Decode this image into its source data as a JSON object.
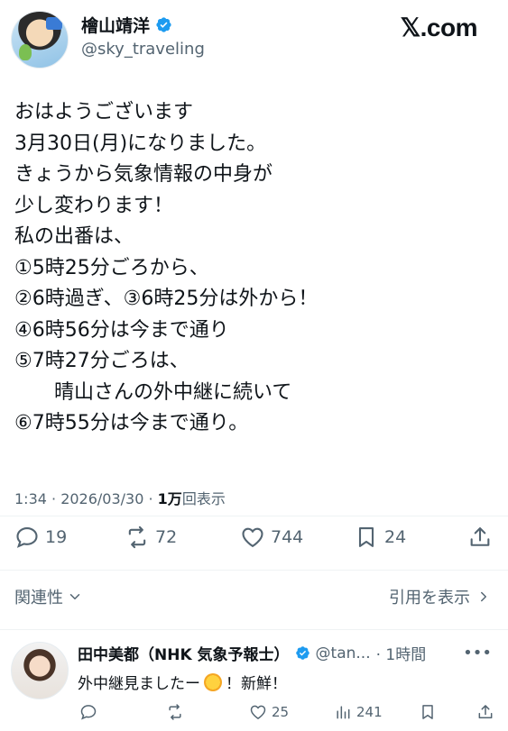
{
  "header": {
    "display_name": "檜山靖洋",
    "handle": "@sky_traveling",
    "brand": "𝕏.com",
    "verified_color": "#1d9bf0"
  },
  "tweet": {
    "text": "おはようございます\n3月30日(月)になりました。\nきょうから気象情報の中身が\n少し変わります！\n私の出番は、\n①5時25分ごろから、\n②6時過ぎ、③6時25分は外から！\n④6時56分は今まで通り\n⑤7時27分ごろは、\n　　晴山さんの外中継に続いて\n⑥7時55分は今まで通り。",
    "time": "1:34 · 2026/03/30 · ",
    "views_count": "1万",
    "views_label": "回表示"
  },
  "actions": {
    "replies": "19",
    "reposts": "72",
    "likes": "744",
    "bookmarks": "24"
  },
  "related": {
    "label": "関連性",
    "quotes_label": "引用を表示"
  },
  "reply": {
    "name": "田中美都（NHK 気象予報士）",
    "handle": "@tan...",
    "time": "· 1時間",
    "text_before": "外中継見ましたー",
    "text_after": "！新鮮！",
    "emoji_icon": "sun-icon",
    "replies": "",
    "reposts": "",
    "likes": "25",
    "views": "241"
  },
  "icons": {
    "reply": "comment-icon",
    "repost": "repost-icon",
    "like": "heart-icon",
    "bookmark": "bookmark-icon",
    "share": "share-icon",
    "views": "views-icon",
    "more": "more-icon"
  }
}
